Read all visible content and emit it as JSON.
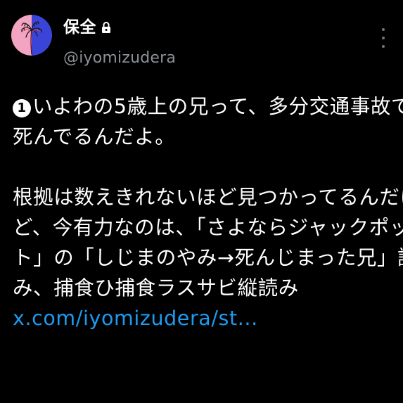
{
  "tweet": {
    "author": {
      "display_name": "保全",
      "handle": "@iyomizudera",
      "avatar_icon": "palm-tree-avatar-icon",
      "protected_icon": "lock-icon",
      "avatar_colors": {
        "left": "#f3a4c1",
        "right": "#3b44d9",
        "tree": "#1a1a1a"
      }
    },
    "menu_icon": "more-vertical-icon",
    "body": {
      "number_badge": "1",
      "lines": [
        "いよわの5歳上の兄って、多分交通事故で",
        "死んでるんだよ。",
        "",
        "根拠は数えきれないほど見つかってるんだけ",
        "ど、今有力なのは、「さよならジャックポッ",
        "ト」の「しじまのやみ→死んじまった兄」読",
        "み、捕食ひ捕食ラスサビ縦読み"
      ],
      "link": "x.com/iyomizudera/st..."
    }
  },
  "colors": {
    "background": "#000000",
    "text": "#ffffff",
    "secondary": "#8b9197",
    "link": "#1d9bf0"
  }
}
